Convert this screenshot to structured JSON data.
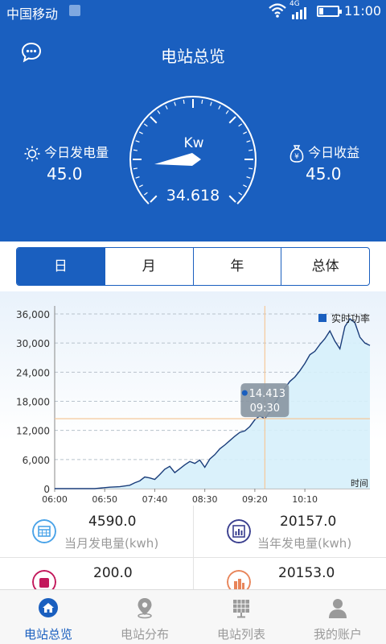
{
  "status_bar": {
    "carrier": "中国移动",
    "network": "4G",
    "time": "11:00"
  },
  "header": {
    "title": "电站总览",
    "gauge_unit": "Kw",
    "gauge_value": "34.618",
    "today_generation": {
      "label": "今日发电量",
      "value": "45.0"
    },
    "today_income": {
      "label": "今日收益",
      "value": "45.0"
    }
  },
  "tabs": [
    {
      "label": "日",
      "active": true
    },
    {
      "label": "月",
      "active": false
    },
    {
      "label": "年",
      "active": false
    },
    {
      "label": "总体",
      "active": false
    }
  ],
  "chart_data": {
    "type": "area",
    "series": [
      {
        "name": "实时功率",
        "color": "#1a5fbf"
      }
    ],
    "x_ticks": [
      "06:00",
      "06:50",
      "07:40",
      "08:30",
      "09:20",
      "10:10"
    ],
    "xlabel": "时间",
    "y_ticks": [
      "0",
      "6,000",
      "12,000",
      "18,000",
      "24,000",
      "30,000",
      "36,000"
    ],
    "ylim": [
      0,
      36000
    ],
    "xlim_minutes": [
      360,
      675
    ],
    "x": [
      "06:00",
      "06:20",
      "06:40",
      "06:55",
      "07:05",
      "07:15",
      "07:20",
      "07:25",
      "07:30",
      "07:35",
      "07:40",
      "07:45",
      "07:50",
      "07:55",
      "08:00",
      "08:05",
      "08:10",
      "08:15",
      "08:20",
      "08:25",
      "08:30",
      "08:35",
      "08:40",
      "08:45",
      "08:50",
      "08:55",
      "09:00",
      "09:05",
      "09:10",
      "09:15",
      "09:20",
      "09:25",
      "09:30",
      "09:35",
      "09:40",
      "09:45",
      "09:50",
      "09:55",
      "10:00",
      "10:05",
      "10:10",
      "10:15",
      "10:20",
      "10:25",
      "10:30",
      "10:35",
      "10:40",
      "10:45",
      "10:50",
      "10:55",
      "11:00",
      "11:05",
      "11:10",
      "11:15"
    ],
    "y": [
      0,
      0,
      0,
      300,
      400,
      700,
      1200,
      1600,
      2400,
      2200,
      1900,
      2900,
      4000,
      4600,
      3300,
      4100,
      4900,
      5600,
      5200,
      5900,
      4400,
      6100,
      7000,
      8200,
      9000,
      9900,
      10800,
      11600,
      11900,
      12800,
      14200,
      15000,
      14413,
      15800,
      17500,
      19300,
      20700,
      22100,
      23000,
      24300,
      25800,
      27600,
      28300,
      29700,
      30900,
      32500,
      30400,
      28800,
      33400,
      35000,
      34200,
      31200,
      30000,
      29500
    ],
    "tooltip": {
      "value": "14.413",
      "time": "09:30"
    },
    "grid": true
  },
  "stats": [
    {
      "value": "4590.0",
      "label": "当月发电量(kwh)",
      "icon": "calendar-icon"
    },
    {
      "value": "20157.0",
      "label": "当年发电量(kwh)",
      "icon": "bar-chart-icon"
    },
    {
      "value": "200.0",
      "label": "",
      "icon": "bag-icon"
    },
    {
      "value": "20153.0",
      "label": "",
      "icon": "building-icon"
    }
  ],
  "nav": [
    {
      "label": "电站总览",
      "active": true,
      "icon": "home-icon"
    },
    {
      "label": "电站分布",
      "active": false,
      "icon": "location-pin-icon"
    },
    {
      "label": "电站列表",
      "active": false,
      "icon": "solar-panel-icon"
    },
    {
      "label": "我的账户",
      "active": false,
      "icon": "user-icon"
    }
  ],
  "colors": {
    "primary": "#1a5fbf",
    "chart_fill": "#d6f0fb",
    "chart_line": "#1a3d7a",
    "crosshair": "#f5c89a"
  }
}
